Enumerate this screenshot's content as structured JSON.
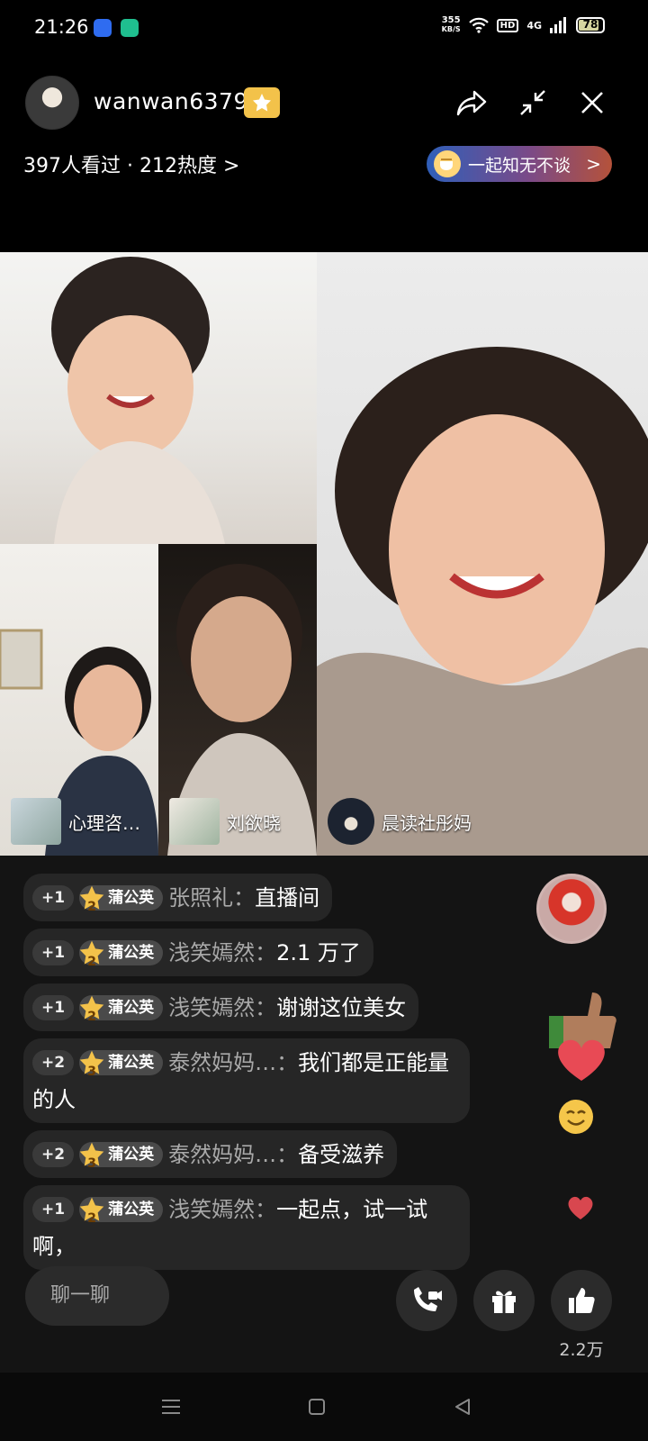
{
  "status_bar": {
    "time": "21:26",
    "net_speed_value": "355",
    "net_speed_unit": "KB/S",
    "hd_label": "HD",
    "network_label": "4G",
    "battery_level": "78"
  },
  "header": {
    "host_name": "wanwan6379",
    "viewers_text": "397人看过 · 212热度",
    "viewers_chevron": ">",
    "topic_label": "一起知无不谈",
    "topic_chevron": ">"
  },
  "video_tiles": [
    {
      "name": ""
    },
    {
      "name": "心理咨…"
    },
    {
      "name": "刘欲晓"
    },
    {
      "name": "晨读社彤妈"
    }
  ],
  "chat_messages": [
    {
      "level": "+1",
      "fan_level": "2",
      "fan_name": "蒲公英",
      "user": "张照礼：",
      "text": "直播间"
    },
    {
      "level": "+1",
      "fan_level": "2",
      "fan_name": "蒲公英",
      "user": "浅笑嫣然：",
      "text": "2.1 万了"
    },
    {
      "level": "+1",
      "fan_level": "2",
      "fan_name": "蒲公英",
      "user": "浅笑嫣然：",
      "text": "谢谢这位美女"
    },
    {
      "level": "+2",
      "fan_level": "3",
      "fan_name": "蒲公英",
      "user": "泰然妈妈…：",
      "text": "我们都是正能量的人"
    },
    {
      "level": "+2",
      "fan_level": "3",
      "fan_name": "蒲公英",
      "user": "泰然妈妈…：",
      "text": "备受滋养"
    },
    {
      "level": "+1",
      "fan_level": "2",
      "fan_name": "蒲公英",
      "user": "浅笑嫣然：",
      "text": "一起点，试一试啊，"
    }
  ],
  "bottom_bar": {
    "chat_placeholder": "聊一聊",
    "like_count": "2.2万"
  },
  "colors": {
    "background": "#141414",
    "fan_badge_star": "#f3c24a",
    "topic_gradient_start": "#2f5fb9",
    "topic_gradient_end": "#b5523a"
  }
}
